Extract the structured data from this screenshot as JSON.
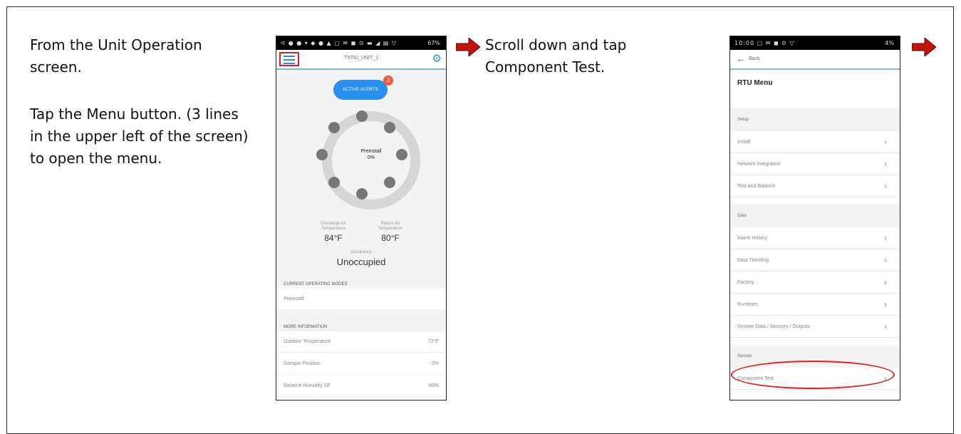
{
  "instructions": {
    "step1_line1": "From the Unit Operation",
    "step1_line2": "screen.",
    "step2_line1": "Tap the Menu button. (3 lines",
    "step2_line2": "in the upper left of the screen)",
    "step2_line3": "to open the menu.",
    "step3_line1": "Scroll down and tap",
    "step3_line2": "Component Test."
  },
  "colors": {
    "arrow": "#c0140c",
    "accent": "#3b86d6",
    "highlight": "#e0201c",
    "alert_button": "#2b8ff0"
  },
  "phone1": {
    "status_left": "ᐊ ● ● ▾ ◆ ● ▲ ▢ ✉ ◼ ⊙ ▬ ◢ ▤ ▽",
    "status_right": "67%",
    "title": "TXTID_UNIT_1",
    "alert_button": "ACTIVE ALERTS",
    "alert_count": "3",
    "ring_center_line1": "Preinstall",
    "ring_center_line2": "0%",
    "discharge_label": "Discharge Air Temperature",
    "discharge_value": "84°F",
    "return_label": "Return Air Temperature",
    "return_value": "80°F",
    "occupancy_label": "Occupancy",
    "occupancy_value": "Unoccupied",
    "current_modes_header": "CURRENT OPERATING MODES",
    "current_mode": "Preinstall",
    "more_info_header": "MORE INFORMATION",
    "info_rows": [
      {
        "label": "Outdoor Temperature",
        "value": "72°F"
      },
      {
        "label": "Damper Position",
        "value": "0%"
      },
      {
        "label": "Relative Humidity SP",
        "value": "60%"
      }
    ]
  },
  "phone2": {
    "status_left": "10:00 ▢ ✉ ◼ ⊙ ▽",
    "status_right": "4%",
    "back_label": "Back",
    "menu_title": "RTU Menu",
    "groups": {
      "setup": "Setup",
      "data": "Data",
      "service": "Service"
    },
    "setup_items": [
      "Install",
      "Network Integration",
      "Test and Balance"
    ],
    "data_items": [
      "Alarm History",
      "Data Trending",
      "Factory",
      "Runtimes",
      "System Data / Sensors / Outputs"
    ],
    "service_items": [
      "Component Test"
    ]
  }
}
